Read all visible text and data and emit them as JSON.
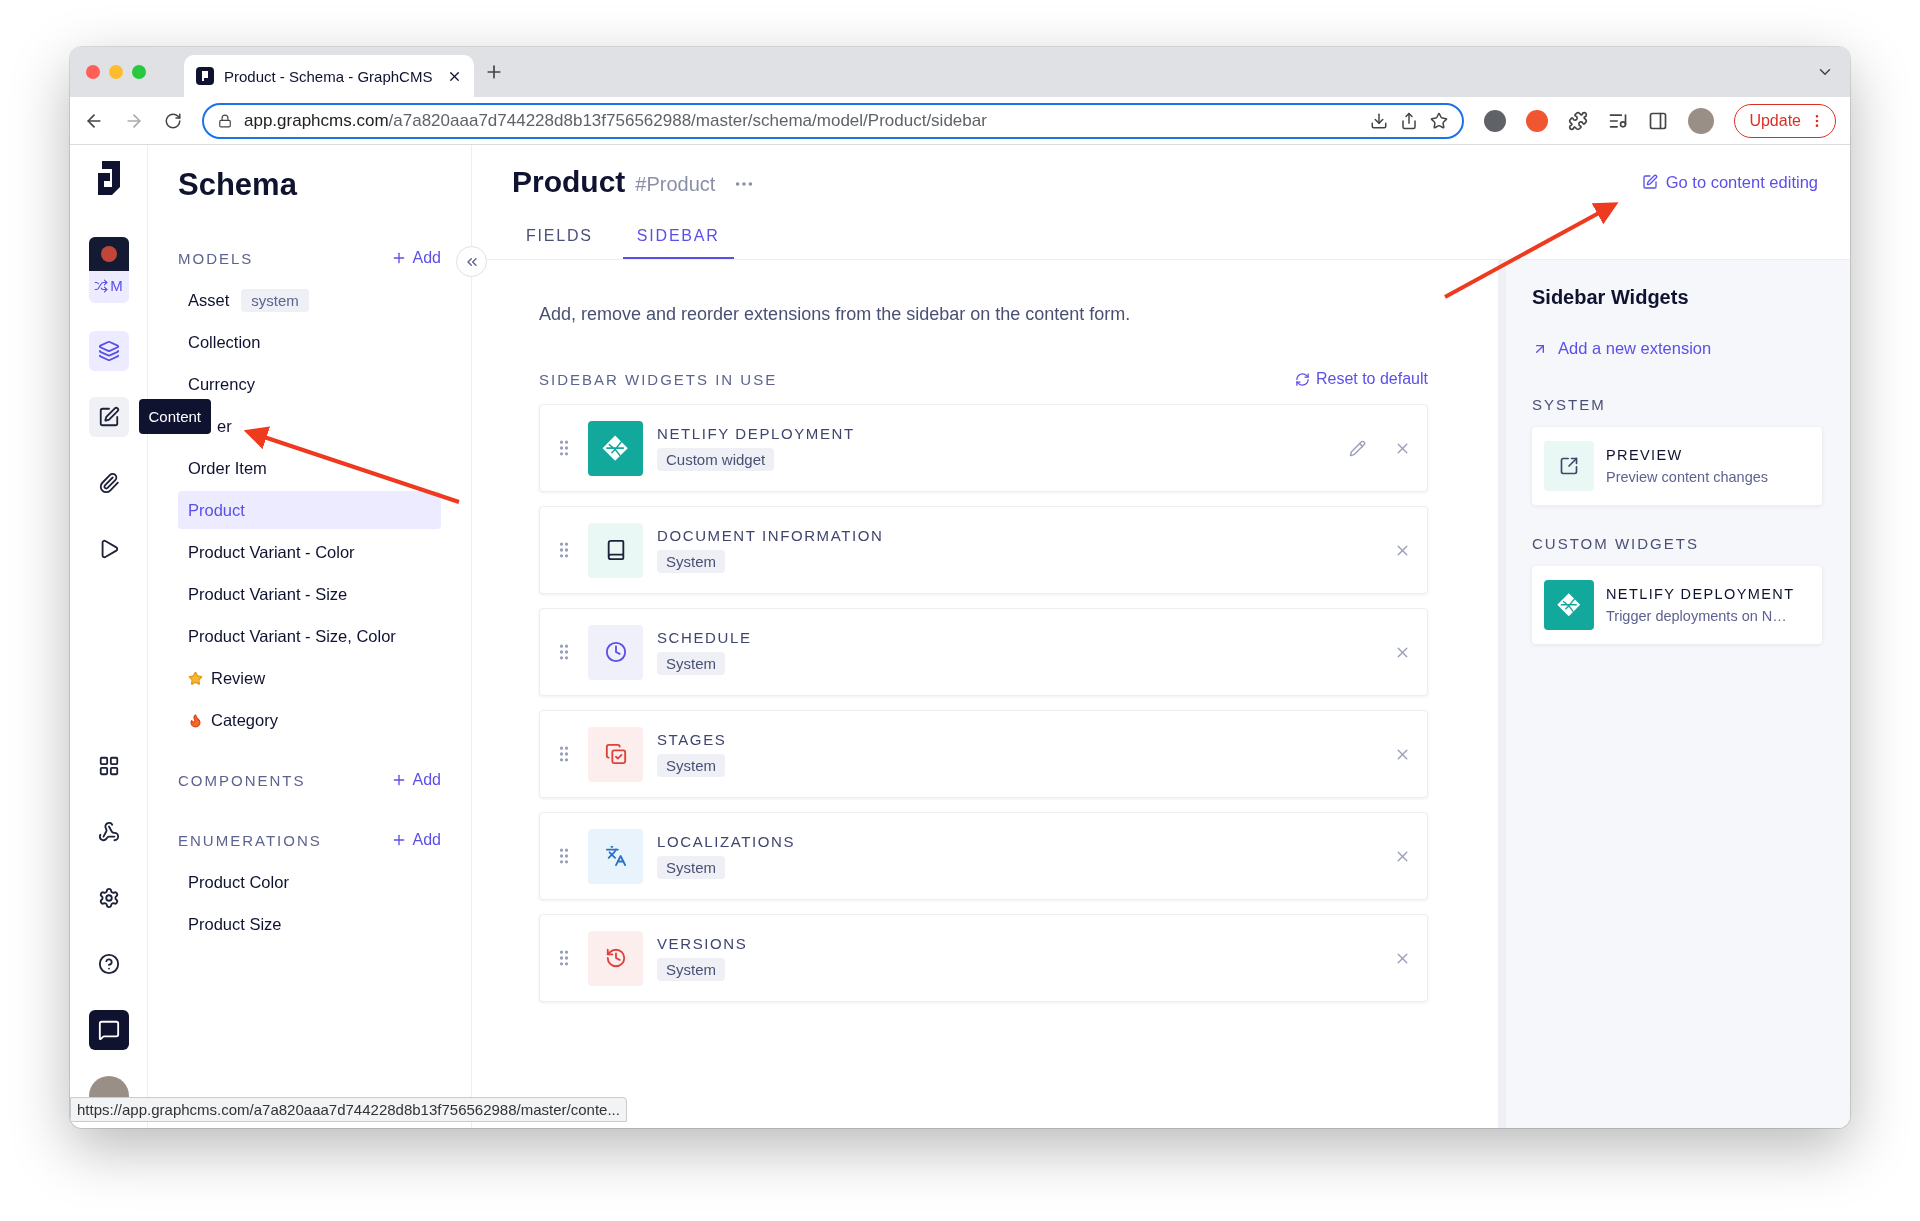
{
  "browser": {
    "tab_title": "Product - Schema - GraphCMS",
    "url_host": "app.graphcms.com",
    "url_path": "/a7a820aaa7d744228d8b13f756562988/master/schema/model/Product/sidebar",
    "update_label": "Update",
    "status_url": "https://app.graphcms.com/a7a820aaa7d744228d8b13f756562988/master/conte..."
  },
  "rail": {
    "project_letter": "M",
    "items": [
      {
        "kind": "schema",
        "selected": true
      },
      {
        "kind": "content",
        "selected": false,
        "tooltip": "Content"
      },
      {
        "kind": "assets",
        "selected": false
      },
      {
        "kind": "playground",
        "selected": false
      }
    ],
    "bottom_items": [
      {
        "kind": "apps"
      },
      {
        "kind": "webhooks"
      },
      {
        "kind": "settings"
      },
      {
        "kind": "help"
      },
      {
        "kind": "chat"
      }
    ]
  },
  "sidebar": {
    "title": "Schema",
    "sections": [
      {
        "heading": "MODELS",
        "add_label": "Add",
        "items": [
          {
            "kind": "plain",
            "label": "Asset",
            "badge": "system",
            "selected": false
          },
          {
            "kind": "plain",
            "label": "Collection",
            "selected": false
          },
          {
            "kind": "plain",
            "label": "Currency",
            "selected": false
          },
          {
            "kind": "plain",
            "label": "er",
            "selected": false,
            "covered_by_tooltip": true
          },
          {
            "kind": "plain",
            "label": "Order Item",
            "selected": false
          },
          {
            "kind": "plain",
            "label": "Product",
            "selected": true
          },
          {
            "kind": "plain",
            "label": "Product Variant - Color",
            "selected": false
          },
          {
            "kind": "plain",
            "label": "Product Variant - Size",
            "selected": false
          },
          {
            "kind": "plain",
            "label": "Product Variant - Size, Color",
            "selected": false
          },
          {
            "kind": "starred",
            "label": "Review",
            "selected": false
          },
          {
            "kind": "hot",
            "label": "Category",
            "selected": false
          }
        ]
      },
      {
        "heading": "COMPONENTS",
        "add_label": "Add"
      },
      {
        "heading": "ENUMERATIONS",
        "add_label": "Add",
        "items": [
          {
            "kind": "plain",
            "label": "Product Color",
            "selected": false
          },
          {
            "kind": "plain",
            "label": "Product Size",
            "selected": false
          }
        ]
      }
    ]
  },
  "main": {
    "title": "Product",
    "api_id": "#Product",
    "content_link": "Go to content editing",
    "tabs": [
      {
        "label": "FIELDS",
        "selected": false
      },
      {
        "label": "SIDEBAR",
        "selected": true
      }
    ],
    "description": "Add, remove and reorder extensions from the sidebar on the content form.",
    "section_heading": "SIDEBAR WIDGETS IN USE",
    "reset_label": "Reset to default",
    "widgets": [
      {
        "kind": "netlify",
        "name": "NETLIFY DEPLOYMENT",
        "tag": "Custom widget",
        "editable": true
      },
      {
        "kind": "document",
        "name": "DOCUMENT INFORMATION",
        "tag": "System",
        "editable": false
      },
      {
        "kind": "schedule",
        "name": "SCHEDULE",
        "tag": "System",
        "editable": false
      },
      {
        "kind": "stages",
        "name": "STAGES",
        "tag": "System",
        "editable": false
      },
      {
        "kind": "localizations",
        "name": "LOCALIZATIONS",
        "tag": "System",
        "editable": false
      },
      {
        "kind": "versions",
        "name": "VERSIONS",
        "tag": "System",
        "editable": false
      }
    ]
  },
  "panel": {
    "title": "Sidebar Widgets",
    "add_link": "Add a new extension",
    "sections": [
      {
        "heading": "SYSTEM",
        "items": [
          {
            "kind": "preview",
            "name": "PREVIEW",
            "description": "Preview content changes"
          }
        ]
      },
      {
        "heading": "CUSTOM WIDGETS",
        "items": [
          {
            "kind": "netlify",
            "name": "NETLIFY DEPLOYMENT",
            "description": "Trigger deployments on N…"
          }
        ]
      }
    ]
  }
}
